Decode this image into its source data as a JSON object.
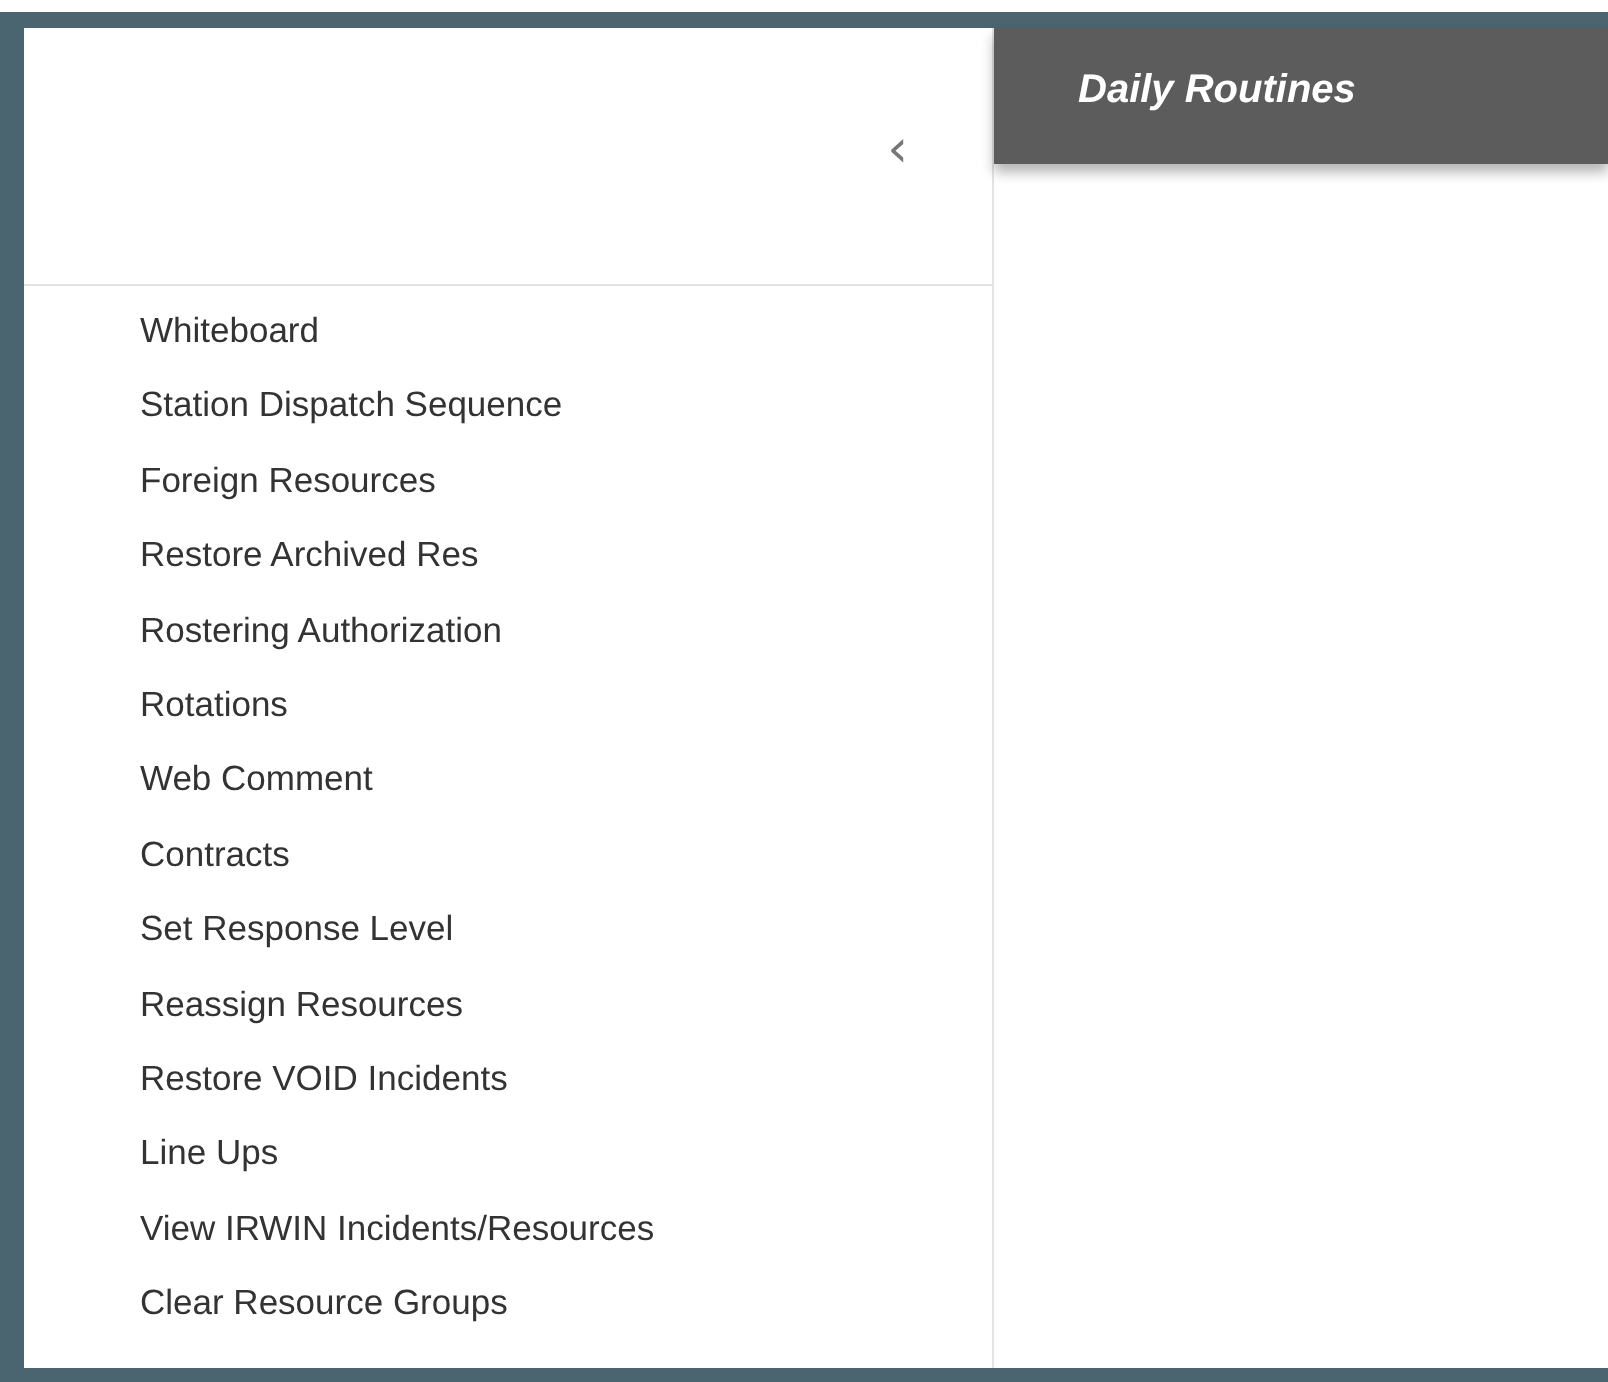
{
  "sidebar": {
    "collapse_button": "‹",
    "items": [
      {
        "label": "Whiteboard"
      },
      {
        "label": "Station Dispatch Sequence"
      },
      {
        "label": "Foreign Resources"
      },
      {
        "label": "Restore Archived Res"
      },
      {
        "label": "Rostering Authorization"
      },
      {
        "label": "Rotations"
      },
      {
        "label": "Web Comment"
      },
      {
        "label": "Contracts"
      },
      {
        "label": "Set Response Level"
      },
      {
        "label": "Reassign Resources"
      },
      {
        "label": "Restore VOID Incidents"
      },
      {
        "label": "Line Ups"
      },
      {
        "label": "View IRWIN Incidents/Resources"
      },
      {
        "label": "Clear Resource Groups"
      }
    ]
  },
  "header": {
    "title": "Daily Routines"
  }
}
